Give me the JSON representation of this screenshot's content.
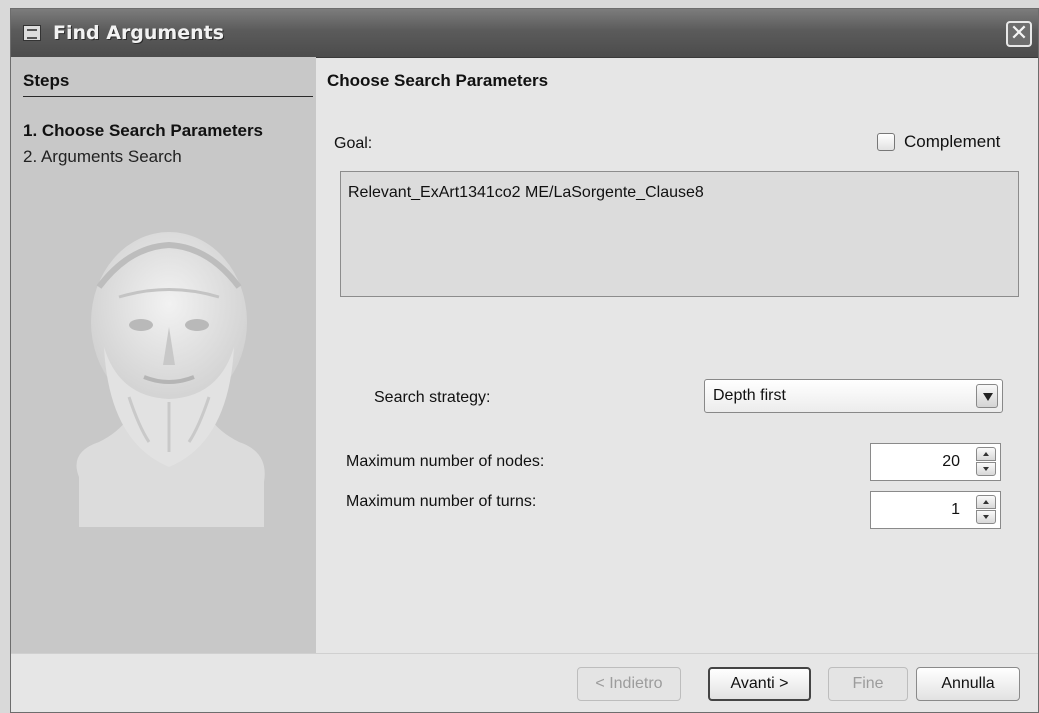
{
  "window": {
    "title": "Find Arguments"
  },
  "steps": {
    "header": "Steps",
    "items": [
      {
        "label": "1. Choose Search Parameters",
        "active": true
      },
      {
        "label": "2. Arguments Search",
        "active": false
      }
    ]
  },
  "main": {
    "section_title": "Choose Search Parameters",
    "goal_label": "Goal:",
    "complement_label": "Complement",
    "complement_checked": false,
    "goal_value": "Relevant_ExArt1341co2 ME/LaSorgente_Clause8",
    "search_strategy_label": "Search strategy:",
    "search_strategy_value": "Depth first",
    "max_nodes_label": "Maximum number of nodes:",
    "max_nodes_value": "20",
    "max_turns_label": "Maximum number of turns:",
    "max_turns_value": "1"
  },
  "buttons": {
    "back": "< Indietro",
    "next": "Avanti >",
    "finish": "Fine",
    "cancel": "Annulla"
  },
  "colors": {
    "titlebar": "#5b5b5b",
    "steps_panel": "#c8c8c8",
    "background": "#e6e6e6"
  },
  "icons": [
    "java-app-icon",
    "close-icon",
    "philosopher-bust-image",
    "chevron-down-icon",
    "spin-up-icon",
    "spin-down-icon"
  ]
}
